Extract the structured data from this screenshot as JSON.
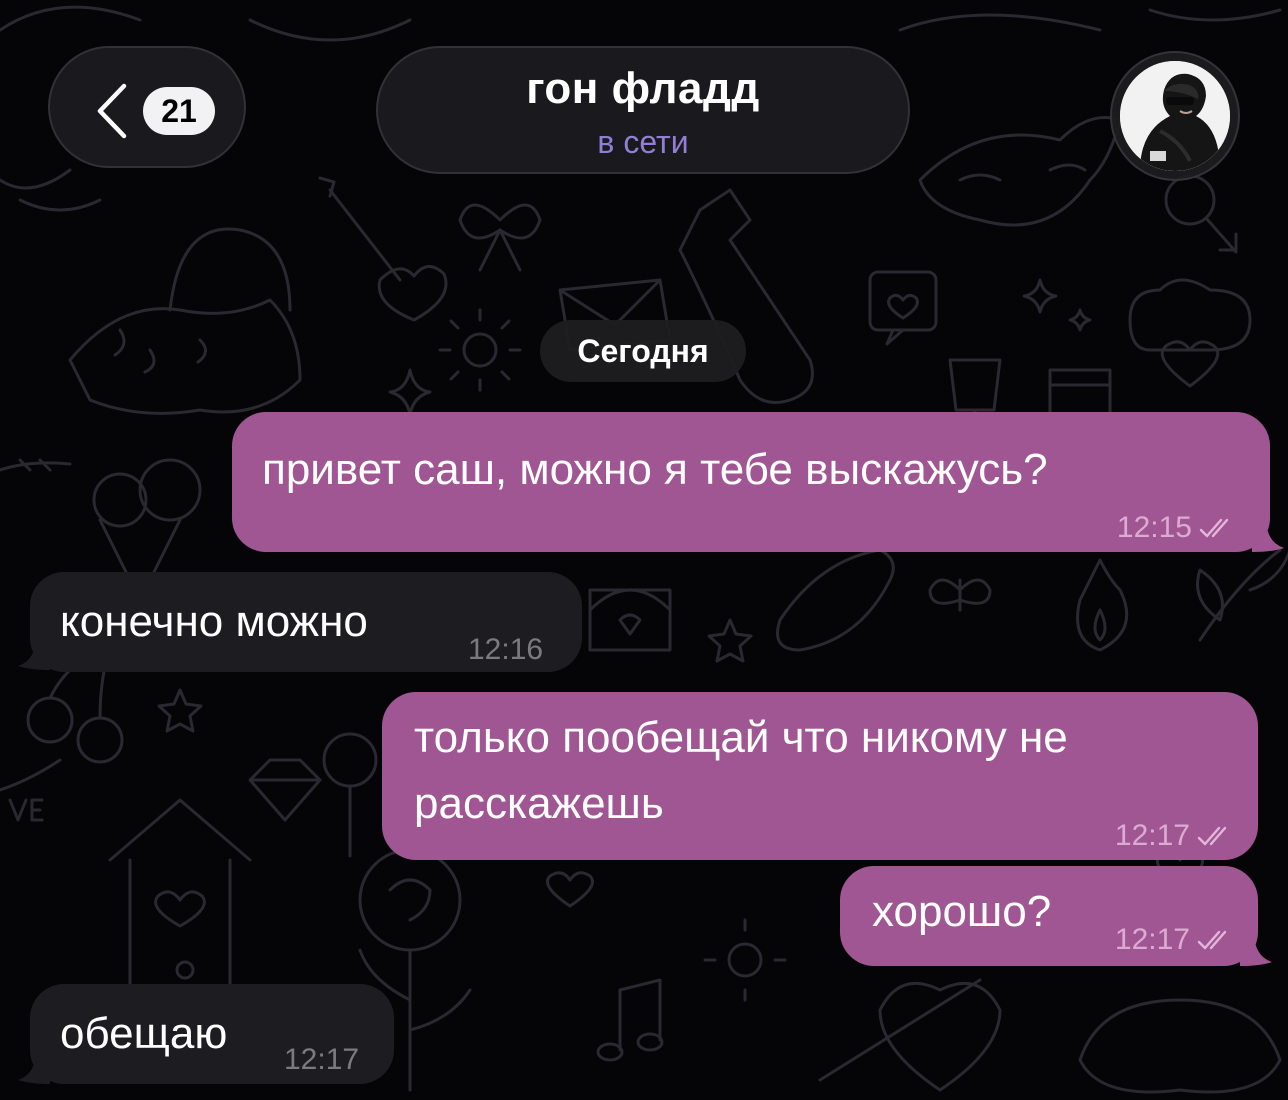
{
  "header": {
    "back_count": "21",
    "chat_name": "гон фладд",
    "status": "в сети"
  },
  "date_divider": "Сегодня",
  "messages": [
    {
      "direction": "out",
      "lines": [
        "привет саш, можно я тебе выскажусь?"
      ],
      "time": "12:15",
      "read": true
    },
    {
      "direction": "in",
      "lines": [
        "конечно можно"
      ],
      "time": "12:16"
    },
    {
      "direction": "out",
      "lines": [
        "только пообещай что никому не",
        "расскажешь"
      ],
      "time": "12:17",
      "read": true
    },
    {
      "direction": "out",
      "lines": [
        "хорошо?"
      ],
      "time": "12:17",
      "read": true
    },
    {
      "direction": "in",
      "lines": [
        "обещаю"
      ],
      "time": "12:17"
    }
  ],
  "colors": {
    "outgoing_bubble": "#a15694",
    "incoming_bubble": "#1d1c20",
    "status_accent": "#8f7fd6",
    "background": "#050406"
  },
  "icons": [
    "chevron-left-icon",
    "double-check-icon",
    "avatar-photo"
  ]
}
